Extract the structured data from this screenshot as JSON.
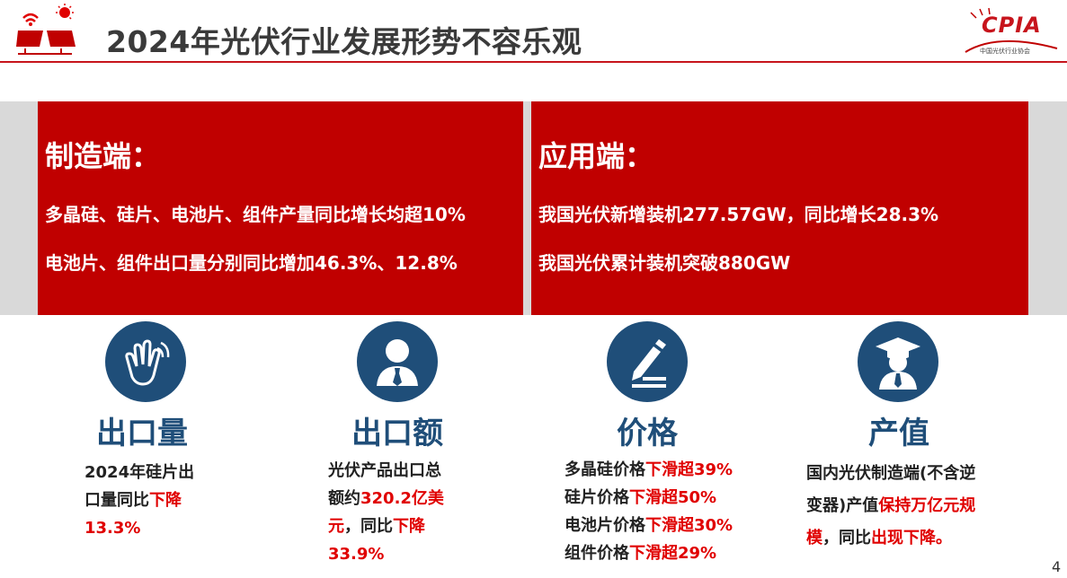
{
  "header": {
    "title": "2024年光伏行业发展形势不容乐观",
    "logo_text": "CPIA",
    "logo_sub": "中国光伏行业协会"
  },
  "left_panel": {
    "heading": "制造端：",
    "line1": "多晶硅、硅片、电池片、组件产量同比增长均超10%",
    "line2": "电池片、组件出口量分别同比增加46.3%、12.8%"
  },
  "right_panel": {
    "heading": "应用端：",
    "line1": "我国光伏新增装机277.57GW，同比增长28.3%",
    "line2": "我国光伏累计装机突破880GW"
  },
  "columns": [
    {
      "icon": "clapping-hands-icon",
      "title": "出口量",
      "t1": "2024年硅片出",
      "t2a": "口量同比",
      "t2b": "下降",
      "t3": "13.3%"
    },
    {
      "icon": "businessman-icon",
      "title": "出口额",
      "t1": "光伏产品出口总",
      "t2a": "额约",
      "t2b": "320.2亿美",
      "t3a": "元",
      "t3b": "，同比",
      "t3c": "下降",
      "t4": "33.9%"
    },
    {
      "icon": "pencil-icon",
      "title": "价格",
      "r1a": "多晶硅价格",
      "r1b": "下滑超39%",
      "r2a": "硅片价格",
      "r2b": "下滑超50%",
      "r3a": "电池片价格",
      "r3b": "下滑超30%",
      "r4a": "组件价格",
      "r4b": "下滑超29%"
    },
    {
      "icon": "graduate-icon",
      "title": "产值",
      "t1": "国内光伏制造端(不含逆",
      "t2a": "变器)产值",
      "t2b": "保持万亿元规",
      "t3a": "模",
      "t3b": "，同比",
      "t3c": "出现下降。"
    }
  ],
  "page_number": "4",
  "colors": {
    "accent_red": "#c00000",
    "navy": "#1f4e79",
    "highlight": "#e00000"
  }
}
